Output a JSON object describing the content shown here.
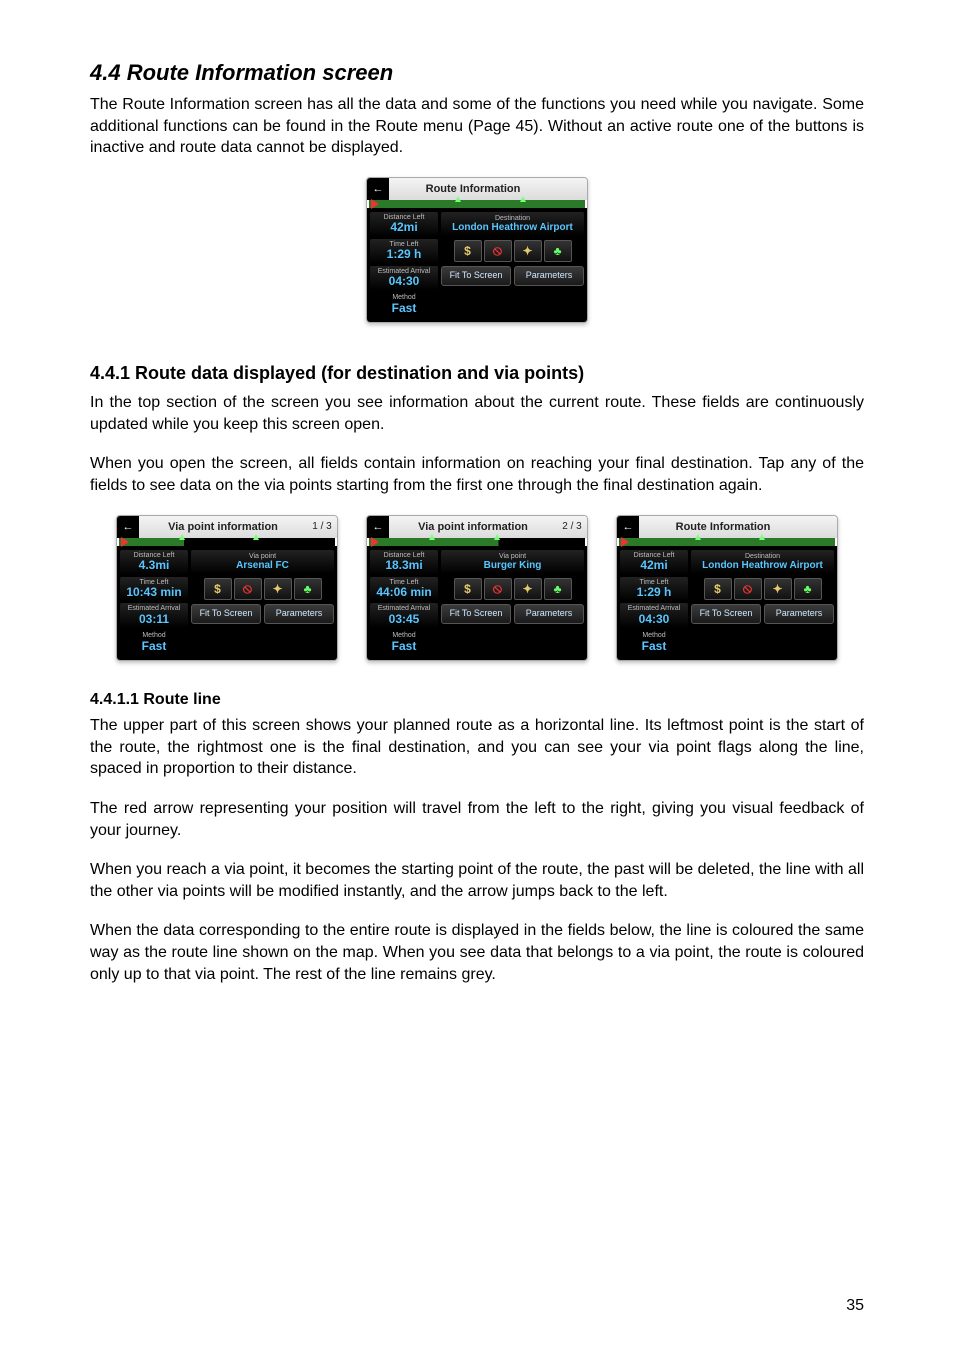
{
  "headings": {
    "h44": "4.4  Route Information screen",
    "h441": "4.4.1  Route data displayed (for destination and via points)",
    "h4411": "4.4.1.1  Route line"
  },
  "paragraphs": {
    "p1": "The Route Information screen has all the data and some of the functions you need while you navigate. Some additional functions can be found in the Route menu (Page 45). Without an active route one of the buttons is inactive and route data cannot be displayed.",
    "p2": "In the top section of the screen you see information about the current route. These fields are continuously updated while you keep this screen open.",
    "p3": "When you open the screen, all fields contain information on reaching your final destination. Tap any of the fields to see data on the via points starting from the first one through the final destination again.",
    "p4": "The upper part of this screen shows your planned route as a horizontal line. Its leftmost point is the start of the route, the rightmost one is the final destination, and you can see your via point flags along the line, spaced in proportion to their distance.",
    "p5": "The red arrow representing your position will travel from the left to the right, giving you visual feedback of your journey.",
    "p6": "When you reach a via point, it becomes the starting point of the route, the past will be deleted, the line with all the other via points will be modified instantly, and the arrow jumps back to the left.",
    "p7": "When the data corresponding to the entire route is displayed in the fields below, the line is coloured the same way as the route line shown on the map. When you see data that belongs to a via point, the route is coloured only up to that via point. The rest of the line remains grey."
  },
  "pageNumber": "35",
  "labels": {
    "distance_left": "Distance Left",
    "time_left": "Time Left",
    "est_arrival": "Estimated Arrival",
    "method": "Method",
    "destination": "Destination",
    "via_point": "Via point"
  },
  "buttons": {
    "fit": "Fit To\nScreen",
    "params": "Parameters"
  },
  "icons": {
    "dollar": "$",
    "stop": "⦸",
    "person": "✦",
    "tree": "♣"
  },
  "shot_main": {
    "title": "Route Information",
    "pager": "",
    "distance": "42mi",
    "time": "1:29 h",
    "eta": "04:30",
    "method_val": "Fast",
    "dest": "London Heathrow Airport"
  },
  "shot1": {
    "title": "Via point information",
    "pager": "1 / 3",
    "distance": "4.3mi",
    "time": "10:43 min",
    "eta": "03:11",
    "method_val": "Fast",
    "dest": "Arsenal FC"
  },
  "shot2": {
    "title": "Via point information",
    "pager": "2 / 3",
    "distance": "18.3mi",
    "time": "44:06 min",
    "eta": "03:45",
    "method_val": "Fast",
    "dest": "Burger King"
  },
  "shot3": {
    "title": "Route Information",
    "pager": "",
    "distance": "42mi",
    "time": "1:29 h",
    "eta": "04:30",
    "method_val": "Fast",
    "dest": "London Heathrow Airport"
  }
}
